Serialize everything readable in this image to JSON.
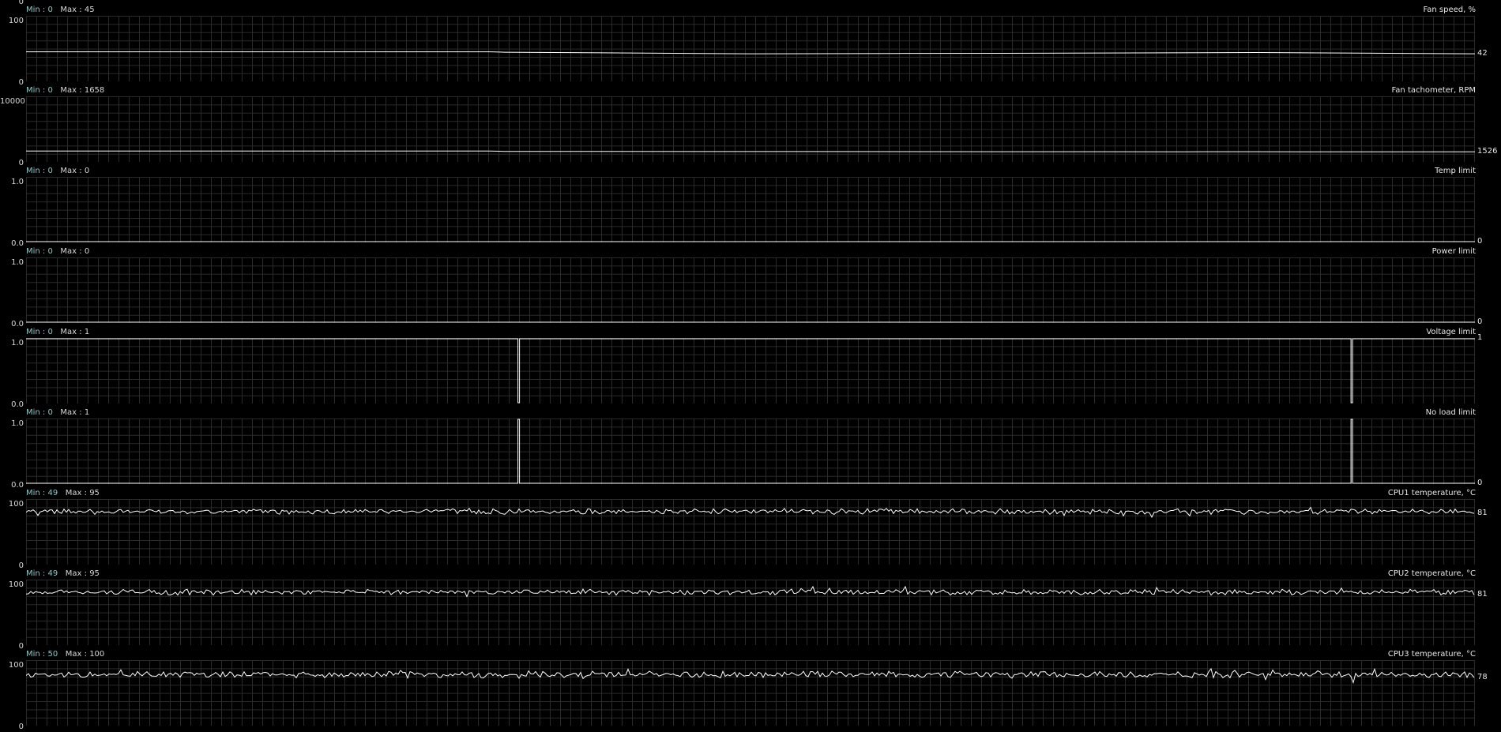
{
  "graphs": [
    {
      "title": "Fan speed, %",
      "min_label": "Min :",
      "min": "0",
      "max_label": "Max :",
      "max": "45",
      "axis_max": "100",
      "axis_min": "0",
      "current": "42",
      "kind": "smooth",
      "level": 0.44,
      "trace": [
        [
          0,
          45
        ],
        [
          0.32,
          45
        ],
        [
          0.33,
          44.5
        ],
        [
          0.5,
          42
        ],
        [
          0.6,
          42.5
        ],
        [
          0.72,
          43
        ],
        [
          0.85,
          44
        ],
        [
          0.92,
          43
        ],
        [
          1,
          42
        ]
      ]
    },
    {
      "title": "Fan tachometer, RPM",
      "min_label": "Min :",
      "min": "0",
      "max_label": "Max :",
      "max": "1658",
      "axis_max": "10000",
      "axis_min": "0",
      "current": "1526",
      "kind": "smooth",
      "trace": [
        [
          0,
          1658
        ],
        [
          0.32,
          1650
        ],
        [
          0.33,
          1600
        ],
        [
          0.8,
          1540
        ],
        [
          0.85,
          1560
        ],
        [
          0.9,
          1530
        ],
        [
          1,
          1526
        ]
      ]
    },
    {
      "title": "Temp limit",
      "min_label": "Min :",
      "min": "0",
      "max_label": "Max :",
      "max": "0",
      "axis_max": "1.0",
      "axis_min": "0.0",
      "current": "0",
      "kind": "flat",
      "value": 0
    },
    {
      "title": "Power limit",
      "min_label": "Min :",
      "min": "0",
      "max_label": "Max :",
      "max": "0",
      "axis_max": "1.0",
      "axis_min": "0.0",
      "current": "0",
      "kind": "flat",
      "value": 0
    },
    {
      "title": "Voltage limit",
      "min_label": "Min :",
      "min": "0",
      "max_label": "Max :",
      "max": "1",
      "axis_max": "1.0",
      "axis_min": "0.0",
      "current": "1",
      "kind": "flat_spikes",
      "value": 1,
      "spikes": [
        0.34,
        0.915
      ]
    },
    {
      "title": "No load limit",
      "min_label": "Min :",
      "min": "0",
      "max_label": "Max :",
      "max": "1",
      "axis_max": "1.0",
      "axis_min": "0.0",
      "current": "0",
      "kind": "flat_spikes",
      "value": 0,
      "spikes": [
        0.34,
        0.915
      ]
    },
    {
      "title": "CPU1 temperature, °C",
      "min_label": "Min :",
      "min": "49",
      "max_label": "Max :",
      "max": "95",
      "axis_max": "100",
      "axis_min": "0",
      "current": "81",
      "kind": "noisy",
      "level": 81,
      "amp": 6
    },
    {
      "title": "CPU2 temperature, °C",
      "min_label": "Min :",
      "min": "49",
      "max_label": "Max :",
      "max": "95",
      "axis_max": "100",
      "axis_min": "0",
      "current": "81",
      "kind": "noisy",
      "level": 81,
      "amp": 6
    },
    {
      "title": "CPU3 temperature, °C",
      "min_label": "Min :",
      "min": "50",
      "max_label": "Max :",
      "max": "100",
      "axis_max": "100",
      "axis_min": "0",
      "current": "78",
      "kind": "noisy",
      "level": 78,
      "amp": 7
    }
  ],
  "colors": {
    "background": "#000000",
    "grid": "#2a2a2a",
    "trace": "#ffffff",
    "minmax_label": "#8fc6c6"
  }
}
